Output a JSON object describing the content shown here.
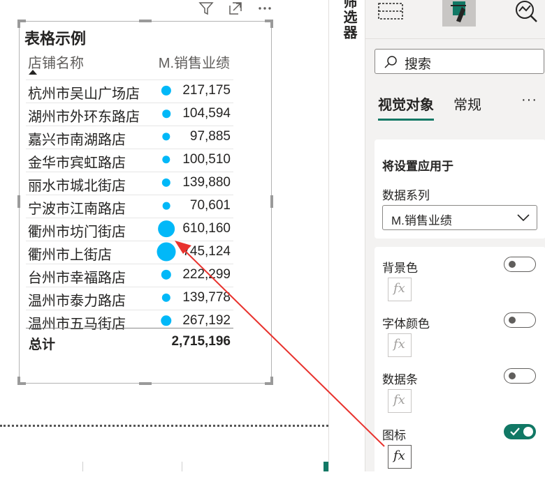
{
  "canvas": {
    "toolbar": {
      "filter_icon": "filter-icon",
      "focus_icon": "focus-mode-icon",
      "more_icon": "more-options-icon"
    },
    "table": {
      "title": "表格示例",
      "columns": {
        "store": "店铺名称",
        "sales": "M.销售业绩"
      },
      "sort_icon": "sort-ascending-icon",
      "rows": [
        {
          "store": "杭州市吴山广场店",
          "value": "217,175",
          "dot_value": 217175
        },
        {
          "store": "湖州市外环东路店",
          "value": "104,594",
          "dot_value": 104594
        },
        {
          "store": "嘉兴市南湖路店",
          "value": "97,885",
          "dot_value": 97885
        },
        {
          "store": "金华市宾虹路店",
          "value": "100,510",
          "dot_value": 100510
        },
        {
          "store": "丽水市城北街店",
          "value": "139,880",
          "dot_value": 139880
        },
        {
          "store": "宁波市江南路店",
          "value": "70,601",
          "dot_value": 70601
        },
        {
          "store": "衢州市坊门街店",
          "value": "610,160",
          "dot_value": 610160
        },
        {
          "store": "衢州市上街店",
          "value": "745,124",
          "dot_value": 745124
        },
        {
          "store": "台州市幸福路店",
          "value": "222,299",
          "dot_value": 222299
        },
        {
          "store": "温州市泰力路店",
          "value": "139,778",
          "dot_value": 139778
        },
        {
          "store": "温州市五马街店",
          "value": "267,192",
          "dot_value": 267192
        }
      ],
      "total_label": "总计",
      "total_value": "2,715,196",
      "icon_color": "#01b8f8"
    }
  },
  "filters_pane": {
    "label": "筛选器"
  },
  "format_pane": {
    "icons": [
      "build-visual-icon",
      "format-visual-icon",
      "analytics-icon"
    ],
    "search_placeholder": "搜索",
    "tabs": [
      "视觉对象",
      "常规"
    ],
    "more": "···",
    "apply_settings": {
      "title": "将设置应用于",
      "series_label": "数据系列",
      "series_value": "M.销售业绩"
    },
    "cell_elements": [
      {
        "label": "背景色",
        "on": false
      },
      {
        "label": "字体颜色",
        "on": false
      },
      {
        "label": "数据条",
        "on": false
      },
      {
        "label": "图标",
        "on": true
      }
    ],
    "fx_label": "fx",
    "accent_color": "#117865"
  },
  "annotation": {
    "arrow_color": "#e8322d"
  }
}
